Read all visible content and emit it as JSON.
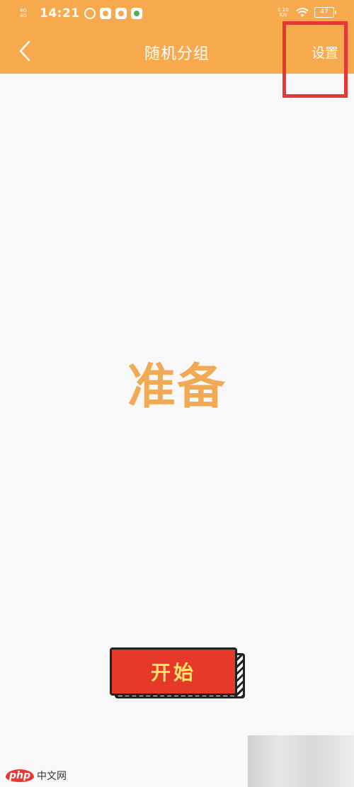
{
  "status_bar": {
    "signal_label": "4G\n4G",
    "time": "14:21",
    "speed": "0.20\nK/s",
    "battery": "47"
  },
  "nav": {
    "title": "随机分组",
    "settings_label": "设置"
  },
  "main": {
    "status_text": "准备",
    "start_label": "开始"
  },
  "watermark": {
    "brand": "php",
    "site": "中文网"
  },
  "colors": {
    "header": "#f7a94e",
    "status_text": "#f0aa55",
    "start_button": "#e53a2a",
    "start_text": "#ffe36b",
    "highlight": "#e53935"
  }
}
